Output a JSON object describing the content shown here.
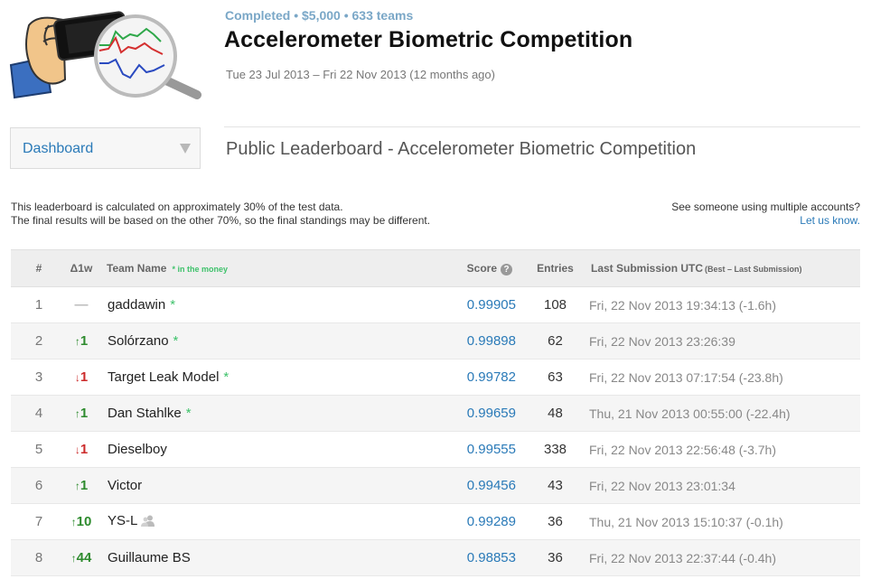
{
  "header": {
    "status": "Completed • $5,000 • 633 teams",
    "title": "Accelerometer Biometric Competition",
    "dates": "Tue 23 Jul 2013 – Fri 22 Nov 2013 (12 months ago)"
  },
  "nav": {
    "dropdown_label": "Dashboard"
  },
  "page": {
    "heading": "Public Leaderboard - Accelerometer Biometric Competition",
    "note_line1": "This leaderboard is calculated on approximately 30% of the test data.",
    "note_line2": "The final results will be based on the other 70%, so the final standings may be different.",
    "multi_accounts_q": "See someone using multiple accounts?",
    "let_us_know": "Let us know."
  },
  "table": {
    "headers": {
      "rank": "#",
      "delta": "Δ1w",
      "team": "Team Name",
      "money_note": "* in the money",
      "score": "Score",
      "entries": "Entries",
      "last": "Last Submission UTC",
      "last_note": "(Best – Last Submission)"
    },
    "rows": [
      {
        "rank": "1",
        "delta_dir": "none",
        "delta": "—",
        "team": "gaddawin",
        "star": true,
        "multi": false,
        "score": "0.99905",
        "entries": "108",
        "last": "Fri, 22 Nov 2013 19:34:13 (-1.6h)"
      },
      {
        "rank": "2",
        "delta_dir": "up",
        "delta": "1",
        "team": "Solórzano",
        "star": true,
        "multi": false,
        "score": "0.99898",
        "entries": "62",
        "last": "Fri, 22 Nov 2013 23:26:39"
      },
      {
        "rank": "3",
        "delta_dir": "down",
        "delta": "1",
        "team": "Target Leak Model",
        "star": true,
        "multi": false,
        "score": "0.99782",
        "entries": "63",
        "last": "Fri, 22 Nov 2013 07:17:54 (-23.8h)"
      },
      {
        "rank": "4",
        "delta_dir": "up",
        "delta": "1",
        "team": "Dan Stahlke",
        "star": true,
        "multi": false,
        "score": "0.99659",
        "entries": "48",
        "last": "Thu, 21 Nov 2013 00:55:00 (-22.4h)"
      },
      {
        "rank": "5",
        "delta_dir": "down",
        "delta": "1",
        "team": "Dieselboy",
        "star": false,
        "multi": false,
        "score": "0.99555",
        "entries": "338",
        "last": "Fri, 22 Nov 2013 22:56:48 (-3.7h)"
      },
      {
        "rank": "6",
        "delta_dir": "up",
        "delta": "1",
        "team": "Victor",
        "star": false,
        "multi": false,
        "score": "0.99456",
        "entries": "43",
        "last": "Fri, 22 Nov 2013 23:01:34"
      },
      {
        "rank": "7",
        "delta_dir": "up",
        "delta": "10",
        "team": "YS-L",
        "star": false,
        "multi": true,
        "score": "0.99289",
        "entries": "36",
        "last": "Thu, 21 Nov 2013 15:10:37 (-0.1h)"
      },
      {
        "rank": "8",
        "delta_dir": "up",
        "delta": "44",
        "team": "Guillaume BS",
        "star": false,
        "multi": false,
        "score": "0.98853",
        "entries": "36",
        "last": "Fri, 22 Nov 2013 22:37:44 (-0.4h)"
      }
    ]
  },
  "icons": {
    "logo": "hand-holding-phone-magnifier-logo",
    "dropdown_caret": "caret-down-icon",
    "score_help": "question-circle-icon",
    "star": "star-icon",
    "team_members": "team-members-icon"
  },
  "colors": {
    "link": "#2a7ab8",
    "status": "#7aa7c7",
    "money": "#3ec26b",
    "up": "#2e8b2e",
    "down": "#cc2b2b"
  }
}
